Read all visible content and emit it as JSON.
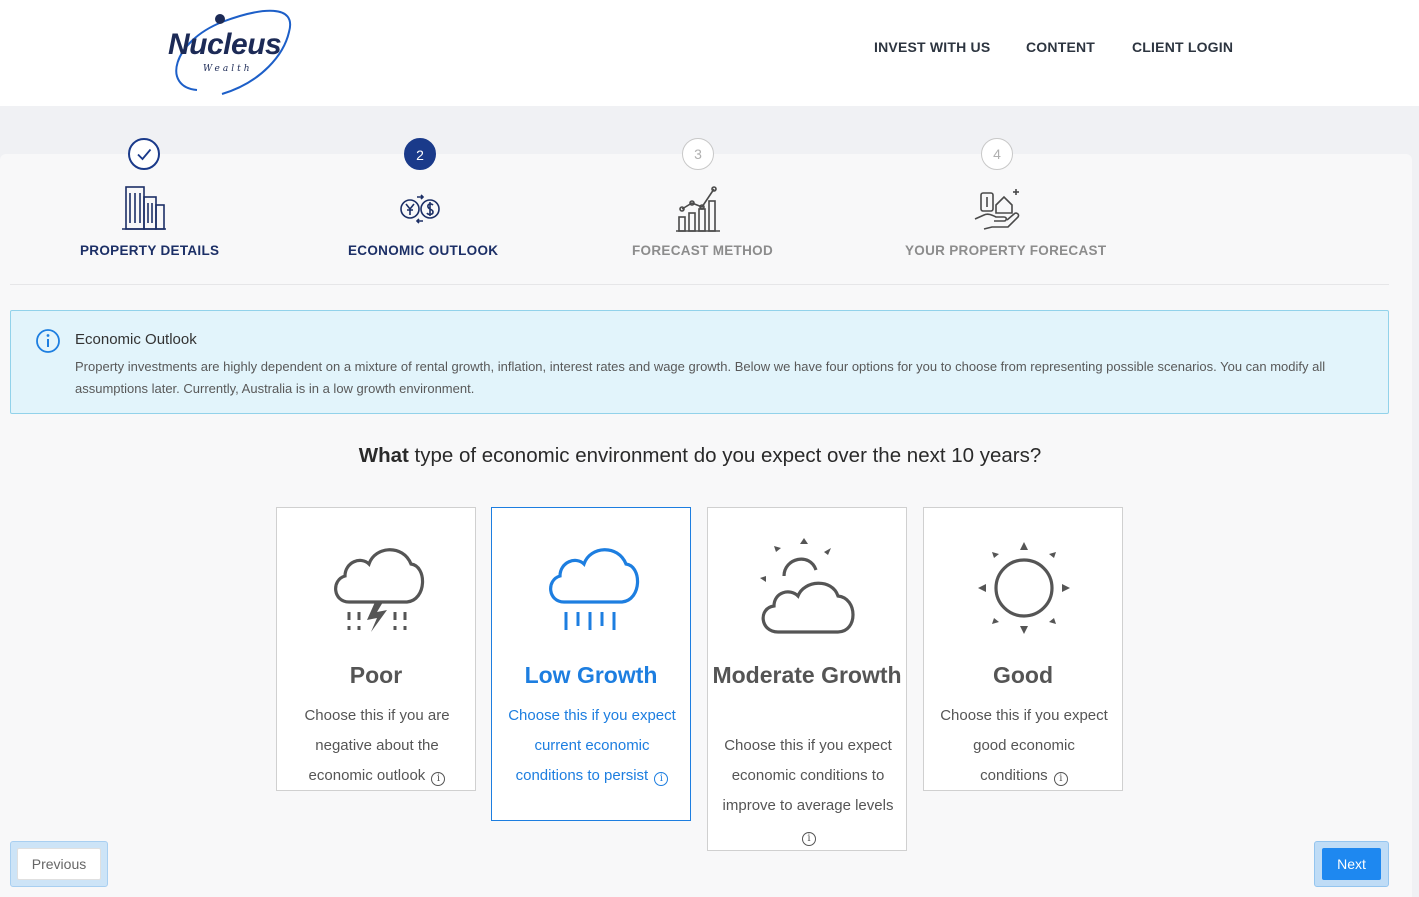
{
  "header": {
    "logo_text": "Nucleus",
    "logo_sub": "Wealth",
    "nav": {
      "invest": "INVEST WITH US",
      "content": "CONTENT",
      "login": "CLIENT LOGIN"
    }
  },
  "steps": [
    {
      "number": "",
      "label": "PROPERTY DETAILS",
      "state": "done",
      "icon": "buildings-icon"
    },
    {
      "number": "2",
      "label": "ECONOMIC OUTLOOK",
      "state": "active",
      "icon": "currency-exchange-icon"
    },
    {
      "number": "3",
      "label": "FORECAST METHOD",
      "state": "todo",
      "icon": "bar-chart-trend-icon"
    },
    {
      "number": "4",
      "label": "YOUR PROPERTY FORECAST",
      "state": "todo",
      "icon": "hand-money-house-icon"
    }
  ],
  "info": {
    "title": "Economic Outlook",
    "body": "Property investments are highly dependent on a mixture of rental growth, inflation, interest rates and wage growth. Below we have four options for you to choose from representing possible scenarios. You can modify all assumptions later. Currently, Australia is in a low growth environment."
  },
  "question": {
    "bold": "What",
    "rest": " type of economic environment do you expect over the next 10 years?"
  },
  "options": [
    {
      "title": "Poor",
      "desc": "Choose this if you are negative about the economic outlook",
      "icon": "storm-cloud-icon",
      "selected": false
    },
    {
      "title": "Low Growth",
      "desc": "Choose this if you expect current economic conditions to persist",
      "icon": "rain-cloud-icon",
      "selected": true
    },
    {
      "title": "Moderate Growth",
      "desc": "Choose this if you expect economic conditions to improve to average levels",
      "icon": "partly-cloudy-icon",
      "selected": false
    },
    {
      "title": "Good",
      "desc": "Choose this if you expect good economic conditions",
      "icon": "sun-icon",
      "selected": false
    }
  ],
  "buttons": {
    "previous": "Previous",
    "next": "Next"
  },
  "colors": {
    "brand_navy": "#1a3a8a",
    "accent_blue": "#1d7ee0",
    "info_bg": "#e2f4fb"
  }
}
